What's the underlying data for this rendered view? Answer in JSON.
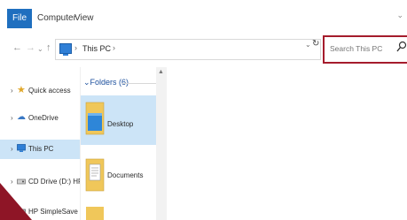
{
  "ribbon": {
    "tabs": [
      "File",
      "Computer",
      "View"
    ]
  },
  "address": {
    "crumbs": [
      "This PC"
    ]
  },
  "search": {
    "placeholder": "Search This PC"
  },
  "navigation": {
    "items": [
      {
        "label": "Quick access",
        "icon": "star-icon"
      },
      {
        "label": "OneDrive",
        "icon": "cloud-icon"
      },
      {
        "label": "This PC",
        "icon": "computer-icon",
        "selected": true
      },
      {
        "label": "CD Drive (D:) HP Law",
        "icon": "disc-drive-icon"
      },
      {
        "label": "HP SimpleSave (F:)",
        "icon": "drive-icon"
      }
    ]
  },
  "content": {
    "group_header": "Folders (6)",
    "folders": [
      {
        "label": "Desktop",
        "selected": true
      },
      {
        "label": "Documents",
        "selected": false
      },
      {
        "label": "",
        "selected": false
      }
    ]
  },
  "colors": {
    "accent": "#1f6fbf",
    "highlight": "#a51c2c",
    "selection": "#cce4f7"
  }
}
